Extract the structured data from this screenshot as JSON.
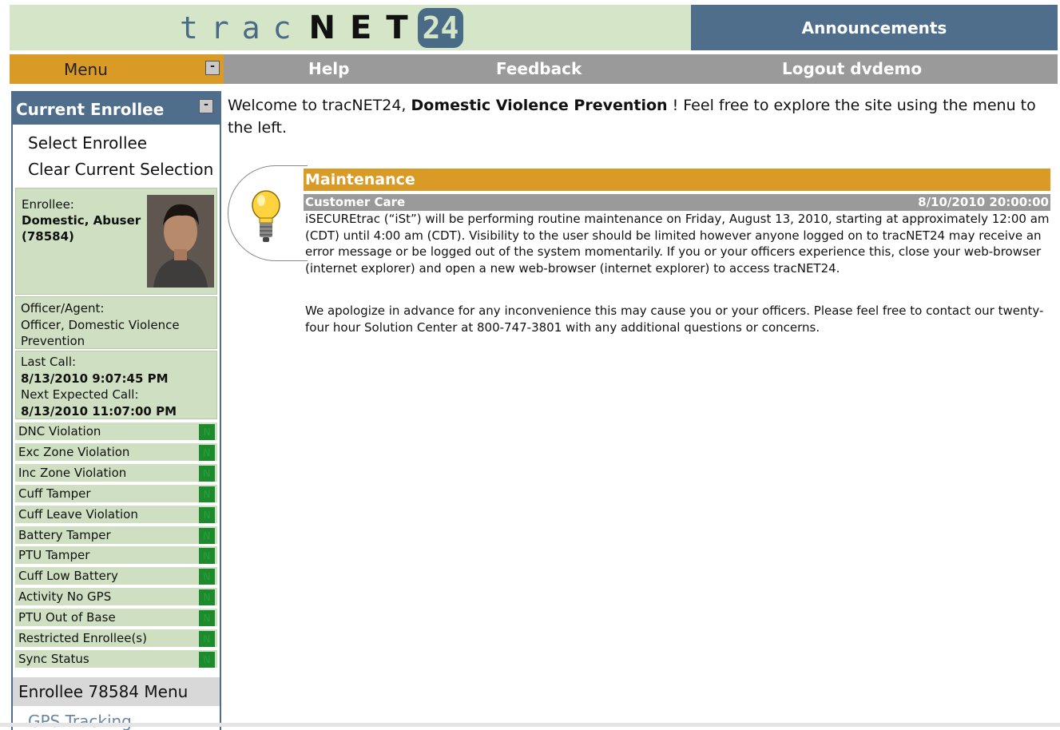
{
  "header": {
    "logo": {
      "light": "trac",
      "bold": "NET",
      "box": "24"
    },
    "announcements_label": "Announcements"
  },
  "nav": {
    "menu_label": "Menu",
    "help_label": "Help",
    "feedback_label": "Feedback",
    "logout_label": "Logout dvdemo"
  },
  "sidebar": {
    "current_enrollee_title": "Current Enrollee",
    "collapse_symbol": "-",
    "select_enrollee": "Select Enrollee",
    "clear_selection": "Clear Current Selection",
    "enrollee_label": "Enrollee:",
    "enrollee_name": "Domestic, Abuser (78584)",
    "officer_label": "Officer/Agent:",
    "officer_name": "Officer, Domestic Violence Prevention",
    "last_call_label": "Last Call:",
    "last_call_value": "8/13/2010 9:07:45 PM",
    "next_call_label": "Next Expected Call:",
    "next_call_value": "8/13/2010 11:07:00 PM",
    "status_rows": [
      {
        "label": "DNC Violation",
        "flag": "N"
      },
      {
        "label": "Exc Zone Violation",
        "flag": "N"
      },
      {
        "label": "Inc Zone Violation",
        "flag": "N"
      },
      {
        "label": "Cuff Tamper",
        "flag": "N"
      },
      {
        "label": "Cuff Leave Violation",
        "flag": "N"
      },
      {
        "label": "Battery Tamper",
        "flag": "N"
      },
      {
        "label": "PTU Tamper",
        "flag": "N"
      },
      {
        "label": "Cuff Low Battery",
        "flag": "N"
      },
      {
        "label": "Activity No GPS",
        "flag": "N"
      },
      {
        "label": "PTU Out of Base",
        "flag": "N"
      },
      {
        "label": "Restricted Enrollee(s)",
        "flag": "N"
      },
      {
        "label": "Sync Status",
        "flag": "N"
      }
    ],
    "enrollee_menu_title": "Enrollee 78584 Menu",
    "gps_tracking": "GPS Tracking"
  },
  "main": {
    "welcome_prefix": "Welcome to tracNET24,",
    "welcome_org": "Domestic Violence Prevention",
    "welcome_suffix": "! Feel free to explore the site using the menu to the left.",
    "maintenance_title": "Maintenance",
    "maintenance_author": "Customer Care",
    "maintenance_date": "8/10/2010 20:00:00",
    "paragraph1": "iSECUREtrac (“iSt”) will be performing routine maintenance on Friday, August 13, 2010, starting at approximately 12:00 am (CDT) until 4:00 am (CDT). Visibility to the user should be limited however anyone logged on to tracNET24 may receive an error message or be logged out of the system momentarily. If you or your officers experience this, close your web-browser (internet explorer) and open a new web-browser (internet explorer) to access tracNET24.",
    "paragraph2": "We apologize in advance for any inconvenience this may cause you or your officers. Please feel free to contact our twenty-four hour Solution Center at 800-747-3801 with any additional questions or concerns."
  },
  "colors": {
    "header_green": "#d5e5c8",
    "header_blue": "#4e6e8c",
    "menu_orange": "#d99b26",
    "nav_gray": "#9a9a9a",
    "status_green": "#1e8a2e"
  }
}
